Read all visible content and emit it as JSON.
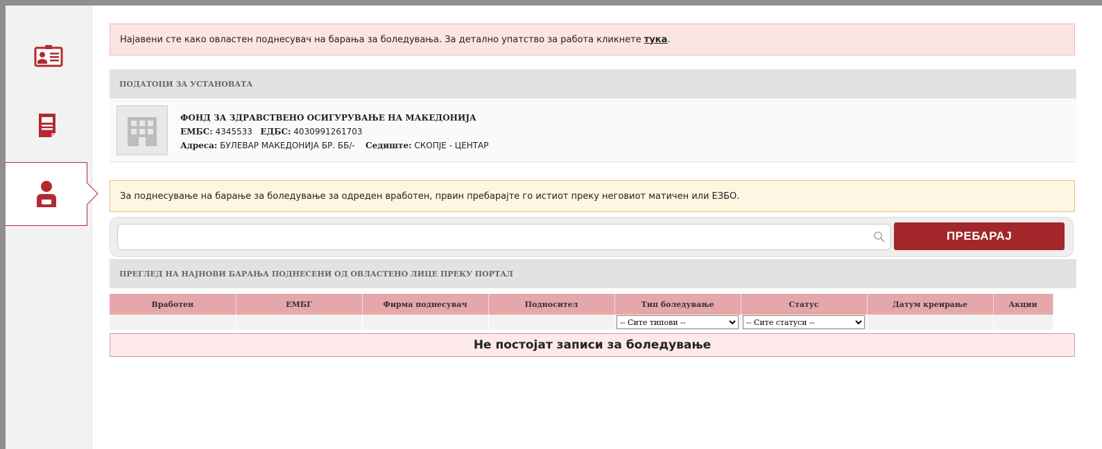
{
  "notice": {
    "text": "Најавени сте како овластен поднесувач на барања за боледувања. За детално упатство за работа кликнете",
    "link": "тука",
    "suffix": "."
  },
  "institution": {
    "section_title": "ПОДАТОЦИ ЗА УСТАНОВАТА",
    "name": "ФОНД ЗА ЗДРАВСТВЕНО ОСИГУРУВАЊЕ НА МАКЕДОНИЈА",
    "embs_label": "ЕМБС:",
    "embs_value": "4345533",
    "edbs_label": "ЕДБС:",
    "edbs_value": "4030991261703",
    "address_label": "Адреса:",
    "address_value": "БУЛЕВАР МАКЕДОНИЈА БР. ББ/-",
    "seat_label": "Седиште:",
    "seat_value": "СКОПЈЕ - ЦЕНТАР"
  },
  "search": {
    "hint": "За поднесување на барање за боледување за одреден вработен, првин пребарајте го истиот преку неговиот матичен или ЕЗБО.",
    "placeholder": "",
    "value": "",
    "button_label": "ПРЕБАРАЈ"
  },
  "requests": {
    "section_title": "ПРЕГЛЕД НА НАЈНОВИ БАРАЊА ПОДНЕСЕНИ ОД ОВЛАСТЕНО ЛИЦЕ ПРЕКУ ПОРТАЛ",
    "columns": [
      "Вработен",
      "ЕМБГ",
      "Фирма поднесувач",
      "Подносител",
      "Тип боледување",
      "Статус",
      "Датум креирање",
      "Акции"
    ],
    "type_filter": "-- Сите типови --",
    "status_filter": "-- Сите статуси --",
    "empty_message": "Не постојат записи за боледување"
  },
  "colors": {
    "accent": "#a3262b",
    "header_row": "#e6a7a8",
    "notice_bg": "#fbe5e3",
    "hint_bg": "#fdf6e2"
  },
  "icons": {
    "sidebar": [
      "id-card-icon",
      "document-icon",
      "user-icon"
    ],
    "institution": "building-icon",
    "search": "search-icon"
  }
}
